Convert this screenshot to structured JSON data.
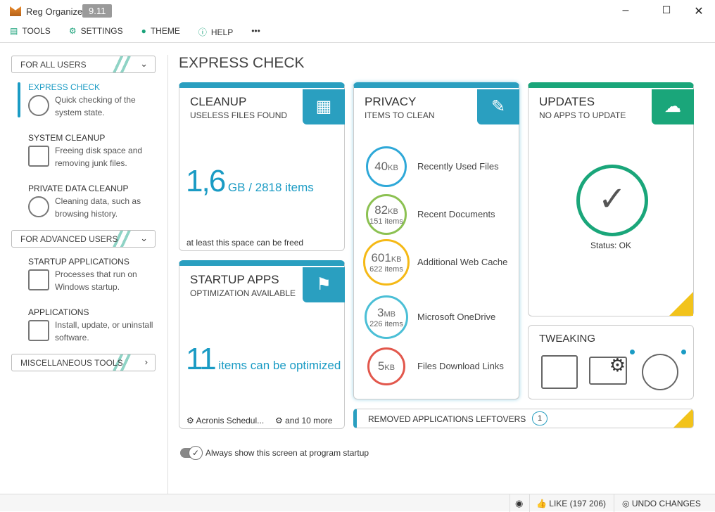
{
  "app": {
    "title": "Reg Organizer",
    "version": "9.11"
  },
  "menu": [
    {
      "label": "TOOLS",
      "icon": "toolbox-icon"
    },
    {
      "label": "SETTINGS",
      "icon": "gear-icon"
    },
    {
      "label": "THEME",
      "icon": "lightbulb-icon"
    },
    {
      "label": "HELP",
      "icon": "help-icon"
    },
    {
      "label": "•••",
      "icon": "more-icon"
    }
  ],
  "sidebar": {
    "for_all": "FOR ALL USERS",
    "items": [
      {
        "title": "EXPRESS CHECK",
        "desc": "Quick checking of the system state."
      },
      {
        "title": "SYSTEM CLEANUP",
        "desc": "Freeing disk space and removing junk files."
      },
      {
        "title": "PRIVATE DATA CLEANUP",
        "desc": "Cleaning data, such as browsing history."
      }
    ],
    "for_advanced": "FOR ADVANCED USERS",
    "adv_items": [
      {
        "title": "STARTUP APPLICATIONS",
        "desc": "Processes that run on Windows startup."
      },
      {
        "title": "APPLICATIONS",
        "desc": "Install, update, or uninstall software."
      }
    ],
    "misc": "MISCELLANEOUS TOOLS"
  },
  "main": {
    "title": "EXPRESS CHECK",
    "cleanup": {
      "title": "CLEANUP",
      "subtitle": "USELESS FILES FOUND",
      "value": "1,6",
      "unit": "GB / 2818 items",
      "note": "at least this space can be freed"
    },
    "startup": {
      "title": "STARTUP APPS",
      "subtitle": "OPTIMIZATION AVAILABLE",
      "value": "11",
      "unit": "items can be optimized",
      "item1": "Acronis Schedul...",
      "item2": "and 10 more"
    },
    "privacy": {
      "title": "PRIVACY",
      "subtitle": "ITEMS TO CLEAN",
      "items": [
        {
          "size": "40",
          "unit": "KB",
          "count": "",
          "label": "Recently Used Files",
          "color": "#2ea8d8"
        },
        {
          "size": "82",
          "unit": "KB",
          "count": "151 items",
          "label": "Recent Documents",
          "color": "#8cc152"
        },
        {
          "size": "601",
          "unit": "KB",
          "count": "622 items",
          "label": "Additional Web Cache",
          "color": "#f5b916"
        },
        {
          "size": "3",
          "unit": "MB",
          "count": "226 items",
          "label": "Microsoft OneDrive",
          "color": "#4bbfd6"
        },
        {
          "size": "5",
          "unit": "KB",
          "count": "",
          "label": "Files Download Links",
          "color": "#e2574c"
        }
      ]
    },
    "updates": {
      "title": "UPDATES",
      "subtitle": "NO APPS TO UPDATE",
      "status": "Status: OK",
      "color": "#1aa67a"
    },
    "tweaking": {
      "title": "TWEAKING"
    },
    "leftovers": {
      "label": "REMOVED APPLICATIONS LEFTOVERS",
      "count": "1"
    },
    "startup_toggle": "Always show this screen at program startup"
  },
  "statusbar": {
    "like": "LIKE (197 206)",
    "undo": "UNDO CHANGES"
  }
}
